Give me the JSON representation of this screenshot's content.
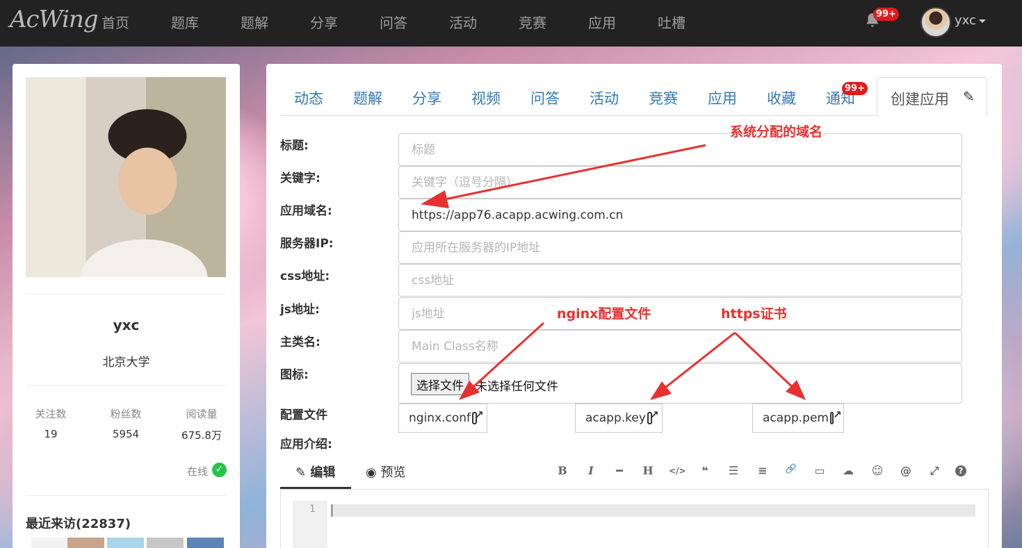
{
  "nav": {
    "logo": "AcWing",
    "items": [
      "首页",
      "题库",
      "题解",
      "分享",
      "问答",
      "活动",
      "竞赛",
      "应用",
      "吐槽"
    ],
    "badge": "99+",
    "user": "yxc"
  },
  "profile": {
    "name": "yxc",
    "school": "北京大学",
    "stats": [
      {
        "label": "关注数",
        "value": "19"
      },
      {
        "label": "粉丝数",
        "value": "5954"
      },
      {
        "label": "阅读量",
        "value": "675.8万"
      }
    ],
    "online": "在线",
    "online_icon": "check-circle-icon",
    "recent_visitors": "最近来访(22837)"
  },
  "tabs": {
    "items": [
      "动态",
      "题解",
      "分享",
      "视频",
      "问答",
      "活动",
      "竞赛",
      "应用",
      "收藏",
      "通知"
    ],
    "notify_badge": "99+",
    "active": "创建应用"
  },
  "form": {
    "title": {
      "label": "标题:",
      "placeholder": "标题",
      "value": ""
    },
    "keywords": {
      "label": "关键字:",
      "placeholder": "关键字（逗号分隔）",
      "value": ""
    },
    "domain": {
      "label": "应用域名:",
      "placeholder": "",
      "value": "https://app76.acapp.acwing.com.cn"
    },
    "server_ip": {
      "label": "服务器IP:",
      "placeholder": "应用所在服务器的IP地址",
      "value": ""
    },
    "css": {
      "label": "css地址:",
      "placeholder": "css地址",
      "value": ""
    },
    "js": {
      "label": "js地址:",
      "placeholder": "js地址",
      "value": ""
    },
    "main_class": {
      "label": "主类名:",
      "placeholder": "Main Class名称",
      "value": ""
    },
    "icon": {
      "label": "图标:",
      "button": "选择文件",
      "status": "未选择任何文件"
    },
    "config": {
      "label": "配置文件",
      "files": [
        "nginx.conf",
        "acapp.key",
        "acapp.pem"
      ]
    },
    "intro": {
      "label": "应用介绍:"
    }
  },
  "editor": {
    "tab_edit": "编辑",
    "tab_preview": "预览",
    "toolbar": [
      "B",
      "I",
      "━",
      "H",
      "</>",
      "❝",
      "☰",
      "≡",
      "🔗",
      "▭",
      "☁",
      "☺",
      "@",
      "⤢",
      "?"
    ],
    "line_number": "1"
  },
  "annotations": {
    "domain": "系统分配的域名",
    "nginx": "nginx配置文件",
    "https": "https证书",
    "color": "#e8312f"
  }
}
